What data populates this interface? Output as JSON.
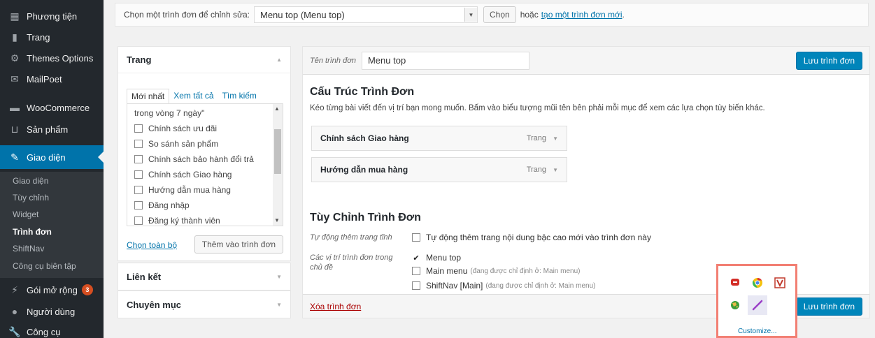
{
  "sidebar": {
    "items": [
      {
        "label": "Phương tiện",
        "icon": "media-icon"
      },
      {
        "label": "Trang",
        "icon": "pages-icon"
      },
      {
        "label": "Themes Options",
        "icon": "gear-icon"
      },
      {
        "label": "MailPoet",
        "icon": "mail-icon"
      },
      {
        "label": "WooCommerce",
        "icon": "woo-icon"
      },
      {
        "label": "Sản phẩm",
        "icon": "cart-icon"
      },
      {
        "label": "Giao diện",
        "icon": "brush-icon"
      },
      {
        "label": "Gói mở rộng",
        "icon": "plugin-icon",
        "badge": "3"
      },
      {
        "label": "Người dùng",
        "icon": "user-icon"
      },
      {
        "label": "Công cụ",
        "icon": "wrench-icon"
      }
    ],
    "submenu": [
      "Giao diện",
      "Tùy chỉnh",
      "Widget",
      "Trình đơn",
      "ShiftNav",
      "Công cụ biên tập"
    ]
  },
  "topbar": {
    "label": "Chọn một trình đơn để chỉnh sửa:",
    "selected": "Menu top (Menu top)",
    "choose_button": "Chọn",
    "or_text": "hoặc",
    "create_link": "tạo một trình đơn mới",
    "period": "."
  },
  "pages_panel": {
    "title": "Trang",
    "tabs": [
      "Mới nhất",
      "Xem tất cả",
      "Tìm kiếm"
    ],
    "truncated_row": "trong vòng 7 ngày\"",
    "rows": [
      "Chính sách ưu đãi",
      "So sánh sản phẩm",
      "Chính sách bảo hành đổi trả",
      "Chính sách Giao hàng",
      "Hướng dẫn mua hàng",
      "Đăng nhập",
      "Đăng ký thành viên"
    ],
    "select_all": "Chọn toàn bộ",
    "add_button": "Thêm vào trình đơn"
  },
  "links_panel": {
    "title": "Liên kết"
  },
  "cats_panel": {
    "title": "Chuyên mục"
  },
  "main": {
    "name_label": "Tên trình đơn",
    "name_value": "Menu top",
    "save_button": "Lưu trình đơn",
    "structure_title": "Cấu Trúc Trình Đơn",
    "structure_desc": "Kéo từng bài viết đến vị trí bạn mong muốn. Bấm vào biểu tượng mũi tên bên phải mỗi mục để xem các lựa chọn tùy biến khác.",
    "menu_items": [
      {
        "title": "Chính sách Giao hàng",
        "type": "Trang"
      },
      {
        "title": "Hướng dẫn mua hàng",
        "type": "Trang"
      }
    ],
    "settings_title": "Tùy Chỉnh Trình Đơn",
    "auto_add_label": "Tự động thêm trang tĩnh",
    "auto_add_option": "Tự động thêm trang nội dung bậc cao mới vào trình đơn này",
    "locations_label": "Các vị trí trình đơn trong chủ đề",
    "locations": [
      {
        "name": "Menu top",
        "checked": true,
        "note": ""
      },
      {
        "name": "Main menu",
        "checked": false,
        "note": "(đang được chỉ định ở: Main menu)"
      },
      {
        "name": "ShiftNav [Main]",
        "checked": false,
        "note": "(đang được chỉ định ở: Main menu)"
      }
    ],
    "delete_link": "Xóa trình đơn"
  },
  "extension_box": {
    "icons": [
      "lastpass-icon",
      "chrome-icon",
      "vivaldi-icon",
      "globe-icon",
      "pen-icon"
    ],
    "customize": "Customize..."
  },
  "colors": {
    "sidebar_bg": "#23282d",
    "accent": "#0073aa",
    "highlight_border": "#f27f73",
    "badge": "#d54e21"
  }
}
